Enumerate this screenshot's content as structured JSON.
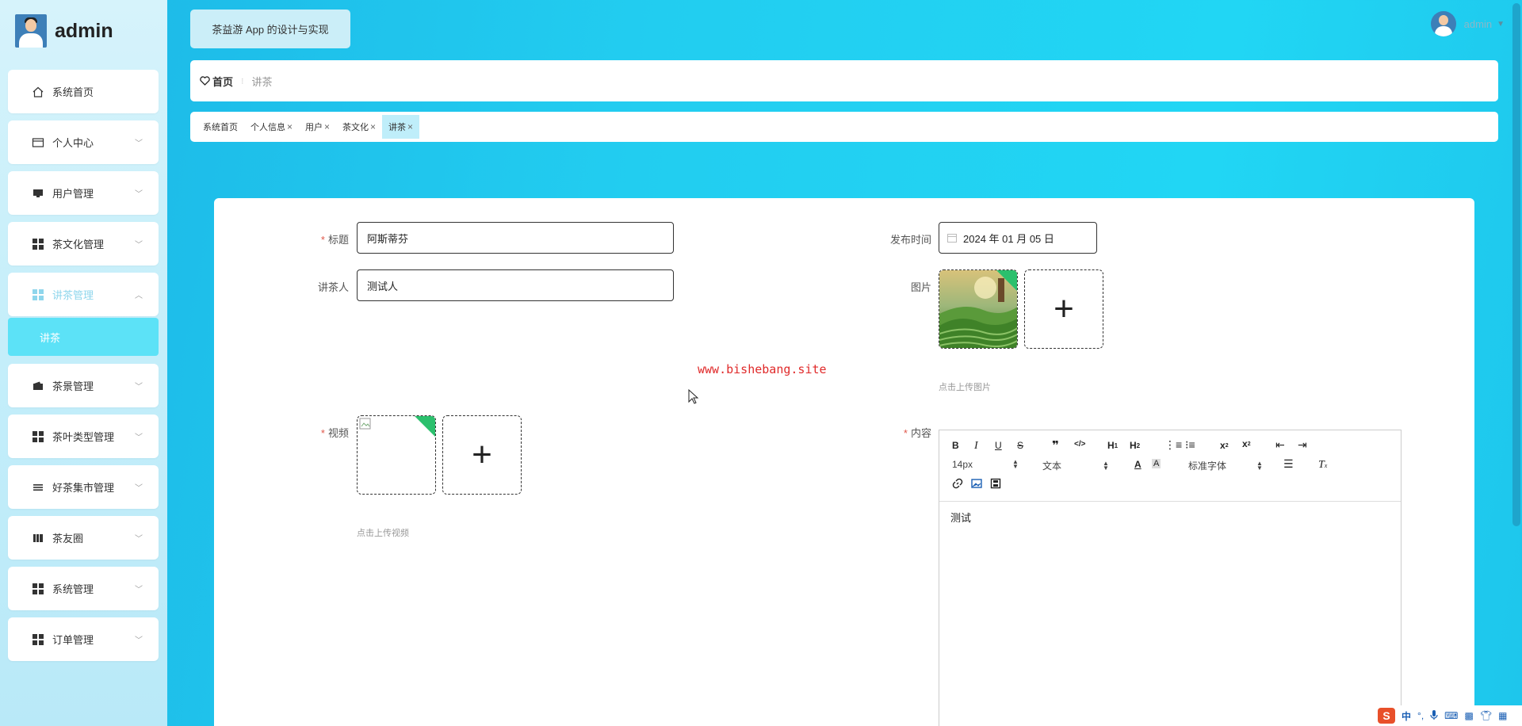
{
  "brand": {
    "name": "admin"
  },
  "sidebar": {
    "items": [
      {
        "label": "系统首页",
        "icon": "home-icon"
      },
      {
        "label": "个人中心",
        "icon": "card-icon"
      },
      {
        "label": "用户管理",
        "icon": "monitor-icon"
      },
      {
        "label": "茶文化管理",
        "icon": "grid-icon"
      },
      {
        "label": "讲茶管理",
        "icon": "grid-icon"
      },
      {
        "label": "茶景管理",
        "icon": "wallet-icon"
      },
      {
        "label": "茶叶类型管理",
        "icon": "grid-icon"
      },
      {
        "label": "好茶集市管理",
        "icon": "list-icon"
      },
      {
        "label": "茶友圈",
        "icon": "book-icon"
      },
      {
        "label": "系统管理",
        "icon": "grid-icon"
      },
      {
        "label": "订单管理",
        "icon": "grid-icon"
      }
    ],
    "submenu_label": "讲茶"
  },
  "header": {
    "app_title": "茶益游 App 的设计与实现",
    "user_name": "admin"
  },
  "breadcrumb": {
    "home": "首页",
    "current": "讲茶"
  },
  "tabs": [
    {
      "label": "系统首页"
    },
    {
      "label": "个人信息"
    },
    {
      "label": "用户"
    },
    {
      "label": "茶文化"
    },
    {
      "label": "讲茶"
    }
  ],
  "form": {
    "title_label": "标题",
    "title_value": "阿斯蒂芬",
    "speaker_label": "讲茶人",
    "speaker_value": "测试人",
    "publish_label": "发布时间",
    "publish_value": "2024 年 01 月 05 日",
    "image_label": "图片",
    "image_hint": "点击上传图片",
    "video_label": "视频",
    "video_hint": "点击上传视频",
    "content_label": "内容",
    "content_value": "测试",
    "add_symbol": "+"
  },
  "editor": {
    "font_size": "14px",
    "text_type": "文本",
    "font_family": "标准字体"
  },
  "watermark": "www.bishebang.site",
  "ime": {
    "logo": "S",
    "lang": "中"
  },
  "colors": {
    "accent": "#22cdf0",
    "active_submenu": "#5ce2f7",
    "upload_corner": "#2bc06d",
    "watermark": "#e02a2a"
  }
}
